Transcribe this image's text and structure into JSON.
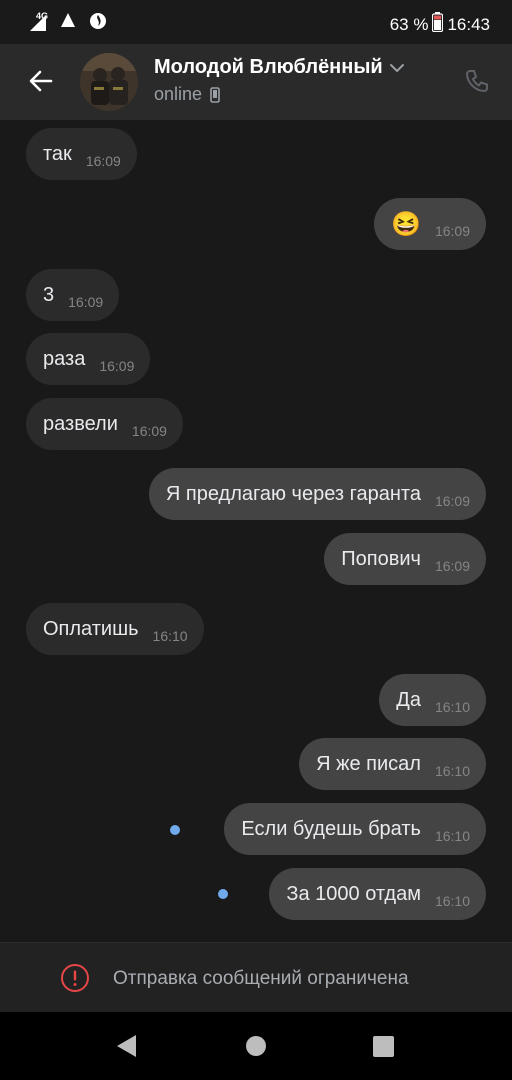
{
  "status_bar": {
    "network_label": "4G",
    "battery_percent": "63 %",
    "time": "16:43"
  },
  "header": {
    "chat_name": "Молодой Влюблённый",
    "status": "online"
  },
  "messages": [
    {
      "direction": "in",
      "text": "так",
      "time": "16:09"
    },
    {
      "direction": "out",
      "text": "😆",
      "time": "16:09"
    },
    {
      "direction": "in",
      "text": "3",
      "time": "16:09"
    },
    {
      "direction": "in",
      "text": "раза",
      "time": "16:09"
    },
    {
      "direction": "in",
      "text": "развели",
      "time": "16:09"
    },
    {
      "direction": "out",
      "text": "Я предлагаю через гаранта",
      "time": "16:09"
    },
    {
      "direction": "out",
      "text": "Попович",
      "time": "16:09"
    },
    {
      "direction": "in",
      "text": "Оплатишь",
      "time": "16:10"
    },
    {
      "direction": "out",
      "text": "Да",
      "time": "16:10"
    },
    {
      "direction": "out",
      "text": "Я же писал",
      "time": "16:10"
    },
    {
      "direction": "out",
      "text": "Если будешь брать",
      "time": "16:10",
      "unread": true
    },
    {
      "direction": "out",
      "text": "За 1000 отдам",
      "time": "16:10",
      "unread": true
    }
  ],
  "restriction_notice": "Отправка сообщений ограничена",
  "colors": {
    "background": "#191919",
    "incoming_bubble": "#2b2b2b",
    "outgoing_bubble": "#444444",
    "unread_dot": "#71aaeb",
    "warning": "#e64646"
  },
  "icons": [
    "back-arrow-icon",
    "chevron-down-icon",
    "mobile-device-icon",
    "phone-icon",
    "warning-icon",
    "nav-back-icon",
    "nav-home-icon",
    "nav-recents-icon"
  ]
}
